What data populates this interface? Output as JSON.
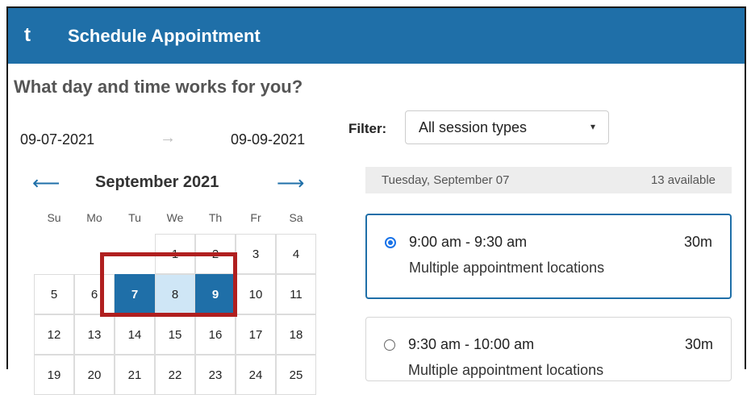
{
  "header": {
    "logo_glyph": "t",
    "title": "Schedule Appointment"
  },
  "question": "What day and time works for you?",
  "range": {
    "start": "09-07-2021",
    "arrow": "→",
    "end": "09-09-2021"
  },
  "calendar": {
    "prev_glyph": "⟵",
    "next_glyph": "⟶",
    "month_label": "September 2021",
    "weekdays": [
      "Su",
      "Mo",
      "Tu",
      "We",
      "Th",
      "Fr",
      "Sa"
    ],
    "week1": [
      "1",
      "2",
      "3",
      "4"
    ],
    "week2": [
      "5",
      "6",
      "7",
      "8",
      "9",
      "10",
      "11"
    ],
    "week3": [
      "12",
      "13",
      "14",
      "15",
      "16",
      "17",
      "18"
    ],
    "week4": [
      "19",
      "20",
      "21",
      "22",
      "23",
      "24",
      "25"
    ],
    "selected_range": [
      "7",
      "8",
      "9"
    ]
  },
  "filter": {
    "label": "Filter:",
    "value": "All session types",
    "caret": "▾"
  },
  "day_bar": {
    "day": "Tuesday, September 07",
    "count": "13 available"
  },
  "slots": [
    {
      "time": "9:00 am - 9:30 am",
      "duration": "30m",
      "location": "Multiple appointment locations",
      "selected": true
    },
    {
      "time": "9:30 am - 10:00 am",
      "duration": "30m",
      "location": "Multiple appointment locations",
      "selected": false
    }
  ],
  "colors": {
    "accent": "#1f6fa8",
    "range_mid": "#cfe6f6",
    "annotation": "#b01f1f"
  }
}
